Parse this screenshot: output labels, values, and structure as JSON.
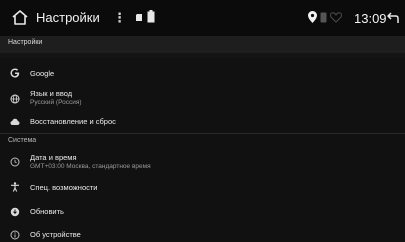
{
  "statusbar": {
    "title": "Настройки",
    "menu_dots": "⋮",
    "time": "13:09"
  },
  "header": {
    "title": "Настройки"
  },
  "items": [
    {
      "label": "Google",
      "icon": "google-icon"
    },
    {
      "label": "Язык и ввод",
      "sub": "Русский (Россия)",
      "icon": "globe-icon"
    },
    {
      "label": "Восстановление и сброс",
      "icon": "cloud-icon"
    }
  ],
  "system": {
    "section_title": "Система",
    "items": [
      {
        "label": "Дата и время",
        "sub": "GMT+03:00 Москва, стандартное время",
        "icon": "clock-icon"
      },
      {
        "label": "Спец. возможности",
        "icon": "accessibility-icon"
      },
      {
        "label": "Обновить",
        "icon": "update-icon"
      },
      {
        "label": "Об устройстве",
        "icon": "info-icon"
      }
    ]
  },
  "colors": {
    "background": "#111111",
    "topbar": "#0b0b0b",
    "subheader": "#1e1e1e",
    "text": "#ececec",
    "subtext": "#9a9a9a"
  }
}
